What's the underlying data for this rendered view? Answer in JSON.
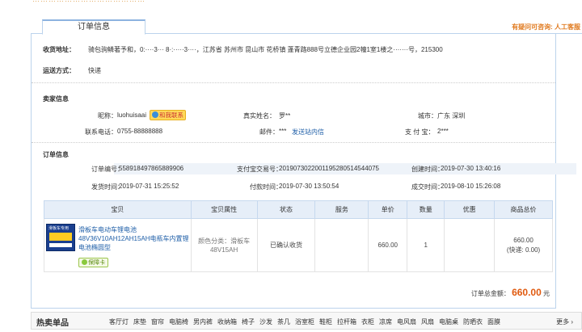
{
  "top_note": "……………………………………",
  "tab_label": "订单信息",
  "help_link": "有疑问可咨询: 人工客服",
  "shipping": {
    "address_label": "收货地址：",
    "address_value": "骑包驹鳞著予和，0:····3··· 8·:·····3····，江苏省 苏州市 昆山市 花桥镇 蓬青路888号立德企业园2幢1室1楼之·······号，215300",
    "method_label": "运送方式：",
    "method_value": "快递"
  },
  "seller": {
    "section_title": "卖家信息",
    "nick_label": "昵称：",
    "nick_value": "luohuisaai",
    "wang_label": "和我联系",
    "realname_label": "真实姓名：",
    "realname_value": "罗**",
    "city_label": "城市：",
    "city_value": "广东 深圳",
    "phone_label": "联系电话：",
    "phone_value": "0755-88888888",
    "email_label": "邮件：",
    "email_value": "***",
    "email_link": "发送站内信",
    "alipay_label": "支 付 宝：",
    "alipay_value": "2***"
  },
  "order": {
    "section_title": "订单信息",
    "order_no_label": "订单编号：",
    "order_no_value": "558918497865889906",
    "trade_no_label": "支付宝交易号：",
    "trade_no_value": "2019073022001195280514544075",
    "created_label": "创建时间：",
    "created_value": "2019-07-30 13:40:16",
    "shipped_label": "发货时间：",
    "shipped_value": "2019-07-31 15:25:52",
    "paid_label": "付款时间：",
    "paid_value": "2019-07-30 13:50:54",
    "done_label": "成交时间：",
    "done_value": "2019-08-10 15:26:08"
  },
  "table": {
    "headers": [
      "宝贝",
      "宝贝属性",
      "状态",
      "服务",
      "单价",
      "数量",
      "优惠",
      "商品总价"
    ],
    "thumb_text": "滑板车专用",
    "product_name": "滑板车电动车锂电池48V36V10AH12AH15AH电瓶车内置锂电池椭圆型",
    "badge": "保障卡",
    "attr": "颜色分类：滑板车48V15AH",
    "status": "已确认收货",
    "service": "",
    "price": "660.00",
    "qty": "1",
    "discount": "",
    "total": "660.00",
    "shipping_fee": "(快递: 0.00)"
  },
  "summary": {
    "label": "订单总金额：",
    "amount": "660.00",
    "unit": "元"
  },
  "hot": {
    "title": "热卖单品",
    "keywords": [
      "客厅灯",
      "床垫",
      "窗帘",
      "电脑椅",
      "男内裤",
      "收纳箱",
      "椅子",
      "沙发",
      "茶几",
      "浴室柜",
      "鞋柜",
      "拉杆箱",
      "衣柜",
      "凉席",
      "电风扇",
      "风扇",
      "电脑桌",
      "防晒衣",
      "面膜"
    ],
    "more": "更多"
  }
}
